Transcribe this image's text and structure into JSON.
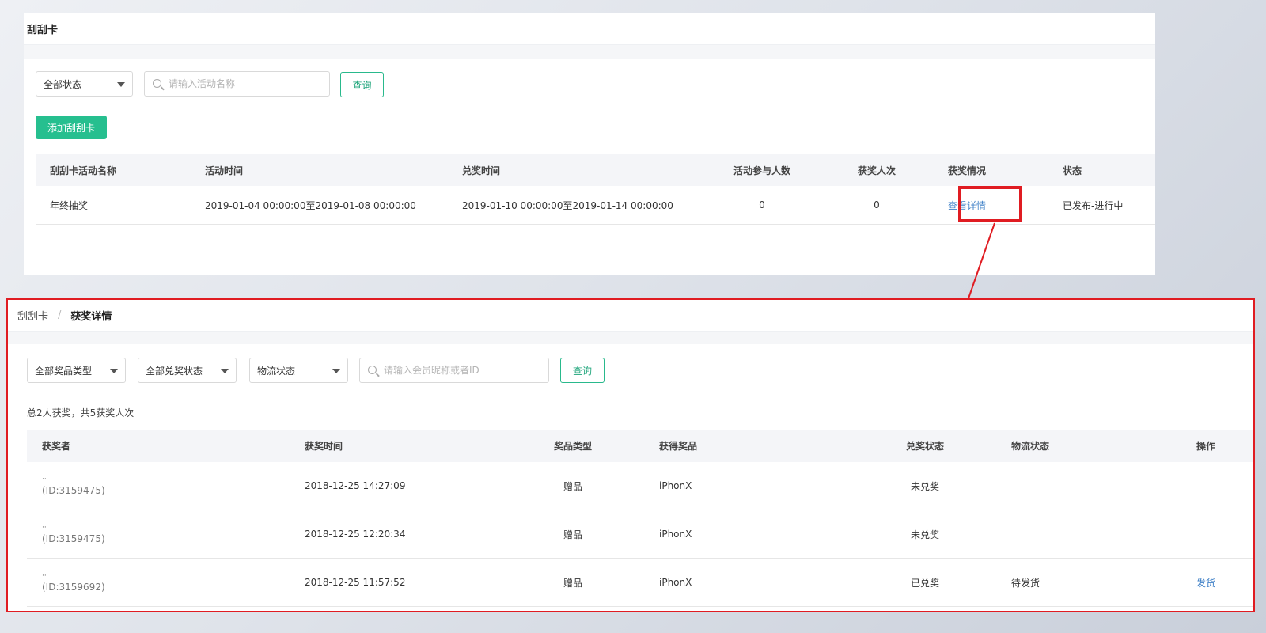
{
  "top": {
    "title": "刮刮卡",
    "status_filter": "全部状态",
    "search_placeholder": "请输入活动名称",
    "query_label": "查询",
    "add_label": "添加刮刮卡",
    "columns": [
      "刮刮卡活动名称",
      "活动时间",
      "兑奖时间",
      "活动参与人数",
      "获奖人次",
      "获奖情况",
      "状态"
    ],
    "row": {
      "name": "年终抽奖",
      "activity_time": "2019-01-04 00:00:00至2019-01-08 00:00:00",
      "redeem_time": "2019-01-10 00:00:00至2019-01-14 00:00:00",
      "participants": "0",
      "winners": "0",
      "detail_link": "查看详情",
      "status": "已发布-进行中"
    }
  },
  "detail": {
    "breadcrumb": {
      "parent": "刮刮卡",
      "separator": "/",
      "current": "获奖详情"
    },
    "filters": {
      "prize_type": "全部奖品类型",
      "redeem_status": "全部兑奖状态",
      "logistics": "物流状态",
      "search_placeholder": "请输入会员昵称或者ID",
      "query_label": "查询"
    },
    "summary": "总2人获奖，共5获奖人次",
    "columns": [
      "获奖者",
      "获奖时间",
      "奖品类型",
      "获得奖品",
      "兑奖状态",
      "物流状态",
      "操作"
    ],
    "rows": [
      {
        "nick": "··",
        "id": "(ID:3159475)",
        "time": "2018-12-25 14:27:09",
        "type": "赠品",
        "prize": "iPhonX",
        "redeem": "未兑奖",
        "logistics": "",
        "action": ""
      },
      {
        "nick": "··",
        "id": "(ID:3159475)",
        "time": "2018-12-25 12:20:34",
        "type": "赠品",
        "prize": "iPhonX",
        "redeem": "未兑奖",
        "logistics": "",
        "action": ""
      },
      {
        "nick": "··",
        "id": "(ID:3159692)",
        "time": "2018-12-25 11:57:52",
        "type": "赠品",
        "prize": "iPhonX",
        "redeem": "已兑奖",
        "logistics": "待发货",
        "action": "发货"
      }
    ]
  },
  "colors": {
    "accent": "#26bf8f",
    "link": "#3f80c7",
    "highlight": "#e01c22"
  }
}
